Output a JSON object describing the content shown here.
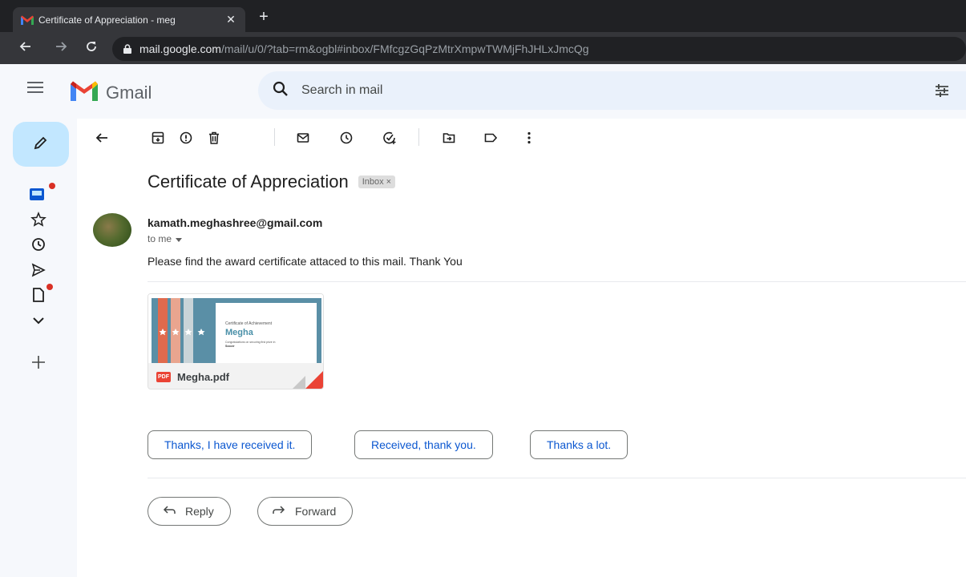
{
  "browser": {
    "tab_title": "Certificate of Appreciation - meg",
    "tab_close": "✕",
    "new_tab": "+",
    "url_host": "mail.google.com",
    "url_path": "/mail/u/0/?tab=rm&ogbl#inbox/FMfcgzGqPzMtrXmpwTWMjFhJHLxJmcQg"
  },
  "header": {
    "product": "Gmail",
    "search_placeholder": "Search in mail"
  },
  "email": {
    "subject": "Certificate of Appreciation",
    "label": "Inbox ×",
    "sender": "kamath.meghashree@gmail.com",
    "recipient": "to me",
    "body": "Please find the award certificate attaced to this mail. Thank You",
    "attachment": {
      "filename": "Megha.pdf",
      "type_badge": "PDF",
      "thumb_heading": "Certificate of Achievement",
      "thumb_name": "Megha",
      "thumb_line": "Congratulations on securing first prize in",
      "thumb_line2": "Soccer"
    }
  },
  "smart_replies": [
    "Thanks, I have received it.",
    "Received, thank you.",
    "Thanks a lot."
  ],
  "actions": {
    "reply": "Reply",
    "forward": "Forward"
  },
  "colors": {
    "accent_blue": "#0b57d0",
    "gmail_red": "#ea4335",
    "compose_bg": "#c2e7ff",
    "notification_dot": "#d93025"
  }
}
